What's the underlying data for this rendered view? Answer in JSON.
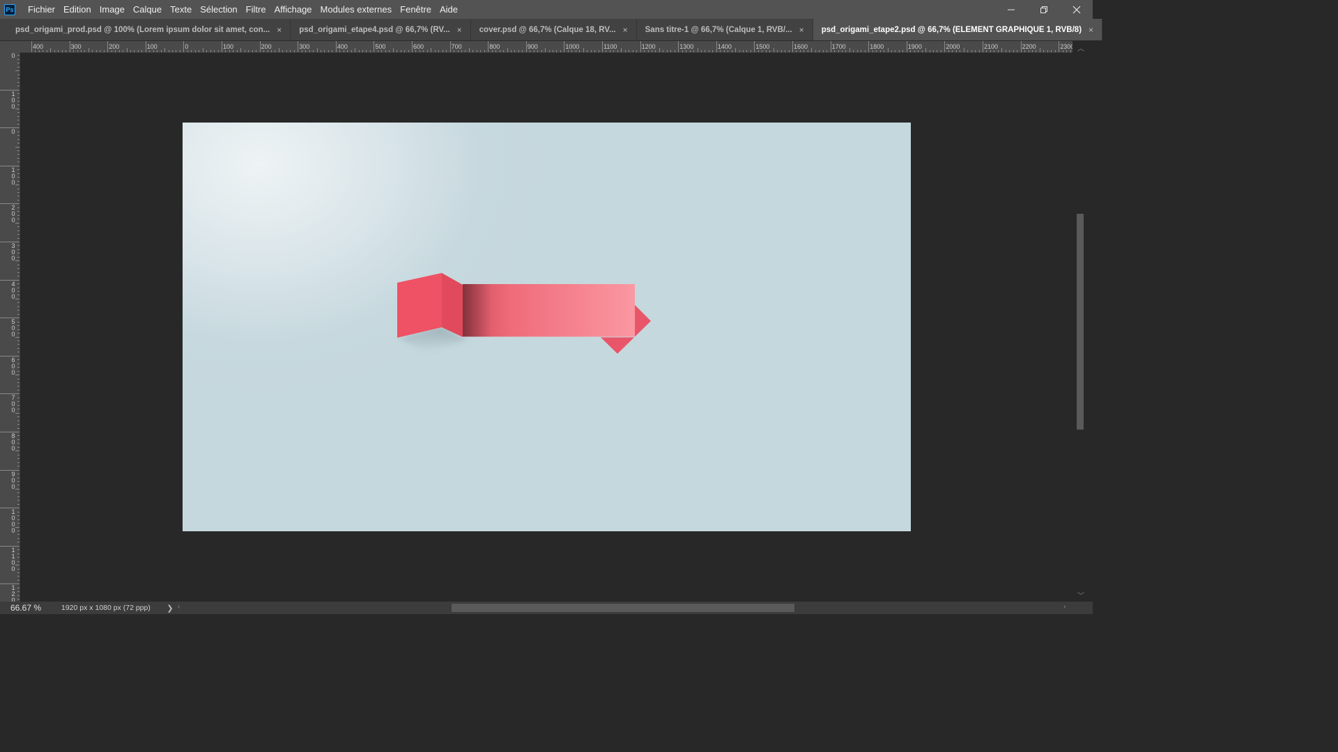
{
  "app": {
    "logo": "Ps"
  },
  "menu": {
    "items": [
      "Fichier",
      "Edition",
      "Image",
      "Calque",
      "Texte",
      "Sélection",
      "Filtre",
      "Affichage",
      "Modules externes",
      "Fenêtre",
      "Aide"
    ]
  },
  "window_controls": {
    "minimize_icon": "minimize-icon",
    "restore_icon": "restore-icon",
    "close_icon": "close-icon"
  },
  "tabs": [
    {
      "label": "psd_origami_prod.psd @ 100% (Lorem ipsum dolor sit amet, con...",
      "active": false
    },
    {
      "label": "psd_origami_etape4.psd @ 66,7% (RV...",
      "active": false
    },
    {
      "label": "cover.psd @ 66,7% (Calque 18, RV...",
      "active": false
    },
    {
      "label": "Sans titre-1 @ 66,7% (Calque 1, RVB/...",
      "active": false
    },
    {
      "label": "psd_origami_etape2.psd @ 66,7% (ELEMENT GRAPHIQUE 1, RVB/8)",
      "active": true
    }
  ],
  "tab_close_glyph": "×",
  "ruler_h": [
    "400",
    "300",
    "200",
    "100",
    "0",
    "100",
    "200",
    "300",
    "400",
    "500",
    "600",
    "700",
    "800",
    "900",
    "1000",
    "1100",
    "1200",
    "1300",
    "1400",
    "1500",
    "1600",
    "1700",
    "1800",
    "1900",
    "2000",
    "2100",
    "2200",
    "2300"
  ],
  "ruler_v": [
    "0",
    "100",
    "0",
    "100",
    "200",
    "300",
    "400",
    "500",
    "600",
    "700",
    "800",
    "900",
    "1000",
    "1100",
    "1200"
  ],
  "status": {
    "zoom": "66.67 %",
    "doc_size": "1920 px x 1080 px (72 ppp)",
    "arrow": "❯"
  },
  "colors": {
    "ribbon_main": "#f06878",
    "ribbon_light": "#fa98a2",
    "ribbon_dark": "#e04a5c",
    "canvas_bg": "#c6d8de"
  }
}
